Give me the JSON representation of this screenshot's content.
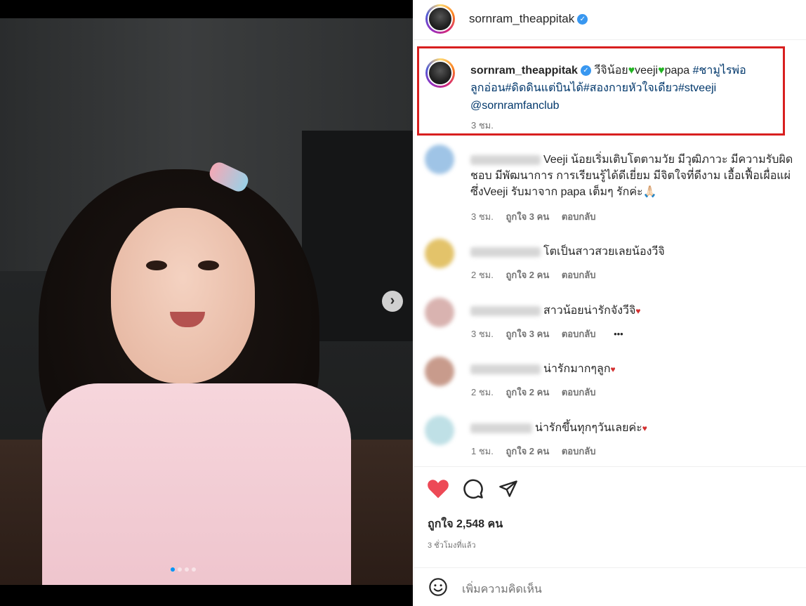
{
  "post": {
    "author": "sornram_theappitak",
    "caption": {
      "text_a": "วีจิน้อย",
      "text_b": "veeji",
      "text_c": "papa",
      "tags_line1": "#ชามูไรพ่อ",
      "tags_line2": "ลูกอ่อน#ดิดดินแต่บินได้#สองกายหัวใจเดียว#stveeji",
      "mention": "@sornramfanclub",
      "time": "3 ชม."
    },
    "carousel": {
      "slides": 4,
      "current": 1
    }
  },
  "comments": [
    {
      "text": "Veeji น้อยเริ่มเติบโตตามวัย มีวุฒิภาวะ มีความรับผิดชอบ มีพัฒนาการ การเรียนรู้ได้ดีเยี่ยม มีจิตใจที่ดีงาม เอื้อเฟื้อเผื่อแผ่ ซึ่งVeeji รับมาจาก papa เต็มๆ รักค่ะ🙏🏻",
      "time": "3 ชม.",
      "likes": "ถูกใจ 3 คน",
      "reply": "ตอบกลับ"
    },
    {
      "text": "โตเป็นสาวสวยเลยน้องวีจิ",
      "time": "2 ชม.",
      "likes": "ถูกใจ 2 คน",
      "reply": "ตอบกลับ"
    },
    {
      "text": "สาวน้อยน่ารักจังวีจิ",
      "time": "3 ชม.",
      "likes": "ถูกใจ 3 คน",
      "reply": "ตอบกลับ",
      "more": "•••"
    },
    {
      "text": "น่ารักมากๆลูก",
      "time": "2 ชม.",
      "likes": "ถูกใจ 2 คน",
      "reply": "ตอบกลับ"
    },
    {
      "text": "น่ารักขึ้นทุกๆวันเลยค่ะ",
      "time": "1 ชม.",
      "likes": "ถูกใจ 2 คน",
      "reply": "ตอบกลับ"
    }
  ],
  "actions": {
    "like_icon": "heart-filled-icon",
    "comment_icon": "comment-bubble-icon",
    "share_icon": "paper-plane-icon",
    "liked_color": "#ed4956"
  },
  "likes_count": "ถูกใจ 2,548 คน",
  "post_time": "3 ชั่วโมงที่แล้ว",
  "add_comment": {
    "placeholder": "เพิ่มความคิดเห็น",
    "emoji_icon": "smiley-icon"
  }
}
